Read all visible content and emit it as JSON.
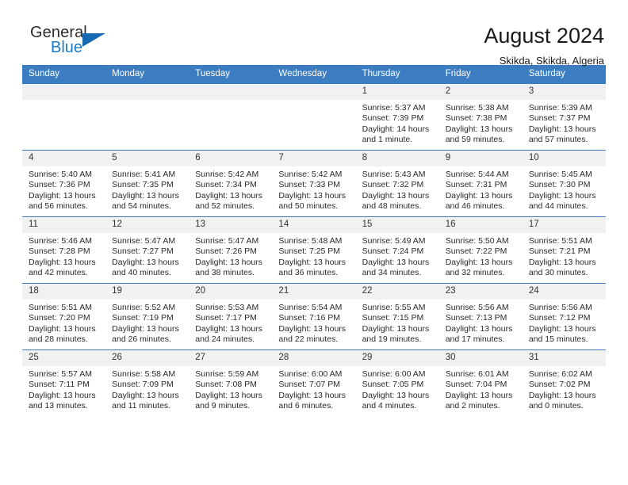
{
  "brand": {
    "name_part1": "General",
    "name_part2": "Blue",
    "logo_icon": "blue-triangle-logo"
  },
  "header": {
    "title": "August 2024",
    "subtitle": "Skikda, Skikda, Algeria"
  },
  "colors": {
    "header_blue": "#3b7dc0",
    "brand_blue": "#1b7bc4",
    "daynum_background": "#f1f1f1",
    "text": "#1a1a1a"
  },
  "calendar": {
    "weekday_headers": [
      "Sunday",
      "Monday",
      "Tuesday",
      "Wednesday",
      "Thursday",
      "Friday",
      "Saturday"
    ],
    "labels": {
      "sunrise": "Sunrise:",
      "sunset": "Sunset:",
      "daylight": "Daylight:"
    },
    "weeks": [
      [
        {
          "day": "",
          "empty": true
        },
        {
          "day": "",
          "empty": true
        },
        {
          "day": "",
          "empty": true
        },
        {
          "day": "",
          "empty": true
        },
        {
          "day": "1",
          "sunrise": "Sunrise: 5:37 AM",
          "sunset": "Sunset: 7:39 PM",
          "daylight_line1": "Daylight: 14 hours",
          "daylight_line2": "and 1 minute."
        },
        {
          "day": "2",
          "sunrise": "Sunrise: 5:38 AM",
          "sunset": "Sunset: 7:38 PM",
          "daylight_line1": "Daylight: 13 hours",
          "daylight_line2": "and 59 minutes."
        },
        {
          "day": "3",
          "sunrise": "Sunrise: 5:39 AM",
          "sunset": "Sunset: 7:37 PM",
          "daylight_line1": "Daylight: 13 hours",
          "daylight_line2": "and 57 minutes."
        }
      ],
      [
        {
          "day": "4",
          "sunrise": "Sunrise: 5:40 AM",
          "sunset": "Sunset: 7:36 PM",
          "daylight_line1": "Daylight: 13 hours",
          "daylight_line2": "and 56 minutes."
        },
        {
          "day": "5",
          "sunrise": "Sunrise: 5:41 AM",
          "sunset": "Sunset: 7:35 PM",
          "daylight_line1": "Daylight: 13 hours",
          "daylight_line2": "and 54 minutes."
        },
        {
          "day": "6",
          "sunrise": "Sunrise: 5:42 AM",
          "sunset": "Sunset: 7:34 PM",
          "daylight_line1": "Daylight: 13 hours",
          "daylight_line2": "and 52 minutes."
        },
        {
          "day": "7",
          "sunrise": "Sunrise: 5:42 AM",
          "sunset": "Sunset: 7:33 PM",
          "daylight_line1": "Daylight: 13 hours",
          "daylight_line2": "and 50 minutes."
        },
        {
          "day": "8",
          "sunrise": "Sunrise: 5:43 AM",
          "sunset": "Sunset: 7:32 PM",
          "daylight_line1": "Daylight: 13 hours",
          "daylight_line2": "and 48 minutes."
        },
        {
          "day": "9",
          "sunrise": "Sunrise: 5:44 AM",
          "sunset": "Sunset: 7:31 PM",
          "daylight_line1": "Daylight: 13 hours",
          "daylight_line2": "and 46 minutes."
        },
        {
          "day": "10",
          "sunrise": "Sunrise: 5:45 AM",
          "sunset": "Sunset: 7:30 PM",
          "daylight_line1": "Daylight: 13 hours",
          "daylight_line2": "and 44 minutes."
        }
      ],
      [
        {
          "day": "11",
          "sunrise": "Sunrise: 5:46 AM",
          "sunset": "Sunset: 7:28 PM",
          "daylight_line1": "Daylight: 13 hours",
          "daylight_line2": "and 42 minutes."
        },
        {
          "day": "12",
          "sunrise": "Sunrise: 5:47 AM",
          "sunset": "Sunset: 7:27 PM",
          "daylight_line1": "Daylight: 13 hours",
          "daylight_line2": "and 40 minutes."
        },
        {
          "day": "13",
          "sunrise": "Sunrise: 5:47 AM",
          "sunset": "Sunset: 7:26 PM",
          "daylight_line1": "Daylight: 13 hours",
          "daylight_line2": "and 38 minutes."
        },
        {
          "day": "14",
          "sunrise": "Sunrise: 5:48 AM",
          "sunset": "Sunset: 7:25 PM",
          "daylight_line1": "Daylight: 13 hours",
          "daylight_line2": "and 36 minutes."
        },
        {
          "day": "15",
          "sunrise": "Sunrise: 5:49 AM",
          "sunset": "Sunset: 7:24 PM",
          "daylight_line1": "Daylight: 13 hours",
          "daylight_line2": "and 34 minutes."
        },
        {
          "day": "16",
          "sunrise": "Sunrise: 5:50 AM",
          "sunset": "Sunset: 7:22 PM",
          "daylight_line1": "Daylight: 13 hours",
          "daylight_line2": "and 32 minutes."
        },
        {
          "day": "17",
          "sunrise": "Sunrise: 5:51 AM",
          "sunset": "Sunset: 7:21 PM",
          "daylight_line1": "Daylight: 13 hours",
          "daylight_line2": "and 30 minutes."
        }
      ],
      [
        {
          "day": "18",
          "sunrise": "Sunrise: 5:51 AM",
          "sunset": "Sunset: 7:20 PM",
          "daylight_line1": "Daylight: 13 hours",
          "daylight_line2": "and 28 minutes."
        },
        {
          "day": "19",
          "sunrise": "Sunrise: 5:52 AM",
          "sunset": "Sunset: 7:19 PM",
          "daylight_line1": "Daylight: 13 hours",
          "daylight_line2": "and 26 minutes."
        },
        {
          "day": "20",
          "sunrise": "Sunrise: 5:53 AM",
          "sunset": "Sunset: 7:17 PM",
          "daylight_line1": "Daylight: 13 hours",
          "daylight_line2": "and 24 minutes."
        },
        {
          "day": "21",
          "sunrise": "Sunrise: 5:54 AM",
          "sunset": "Sunset: 7:16 PM",
          "daylight_line1": "Daylight: 13 hours",
          "daylight_line2": "and 22 minutes."
        },
        {
          "day": "22",
          "sunrise": "Sunrise: 5:55 AM",
          "sunset": "Sunset: 7:15 PM",
          "daylight_line1": "Daylight: 13 hours",
          "daylight_line2": "and 19 minutes."
        },
        {
          "day": "23",
          "sunrise": "Sunrise: 5:56 AM",
          "sunset": "Sunset: 7:13 PM",
          "daylight_line1": "Daylight: 13 hours",
          "daylight_line2": "and 17 minutes."
        },
        {
          "day": "24",
          "sunrise": "Sunrise: 5:56 AM",
          "sunset": "Sunset: 7:12 PM",
          "daylight_line1": "Daylight: 13 hours",
          "daylight_line2": "and 15 minutes."
        }
      ],
      [
        {
          "day": "25",
          "sunrise": "Sunrise: 5:57 AM",
          "sunset": "Sunset: 7:11 PM",
          "daylight_line1": "Daylight: 13 hours",
          "daylight_line2": "and 13 minutes."
        },
        {
          "day": "26",
          "sunrise": "Sunrise: 5:58 AM",
          "sunset": "Sunset: 7:09 PM",
          "daylight_line1": "Daylight: 13 hours",
          "daylight_line2": "and 11 minutes."
        },
        {
          "day": "27",
          "sunrise": "Sunrise: 5:59 AM",
          "sunset": "Sunset: 7:08 PM",
          "daylight_line1": "Daylight: 13 hours",
          "daylight_line2": "and 9 minutes."
        },
        {
          "day": "28",
          "sunrise": "Sunrise: 6:00 AM",
          "sunset": "Sunset: 7:07 PM",
          "daylight_line1": "Daylight: 13 hours",
          "daylight_line2": "and 6 minutes."
        },
        {
          "day": "29",
          "sunrise": "Sunrise: 6:00 AM",
          "sunset": "Sunset: 7:05 PM",
          "daylight_line1": "Daylight: 13 hours",
          "daylight_line2": "and 4 minutes."
        },
        {
          "day": "30",
          "sunrise": "Sunrise: 6:01 AM",
          "sunset": "Sunset: 7:04 PM",
          "daylight_line1": "Daylight: 13 hours",
          "daylight_line2": "and 2 minutes."
        },
        {
          "day": "31",
          "sunrise": "Sunrise: 6:02 AM",
          "sunset": "Sunset: 7:02 PM",
          "daylight_line1": "Daylight: 13 hours",
          "daylight_line2": "and 0 minutes."
        }
      ]
    ]
  }
}
